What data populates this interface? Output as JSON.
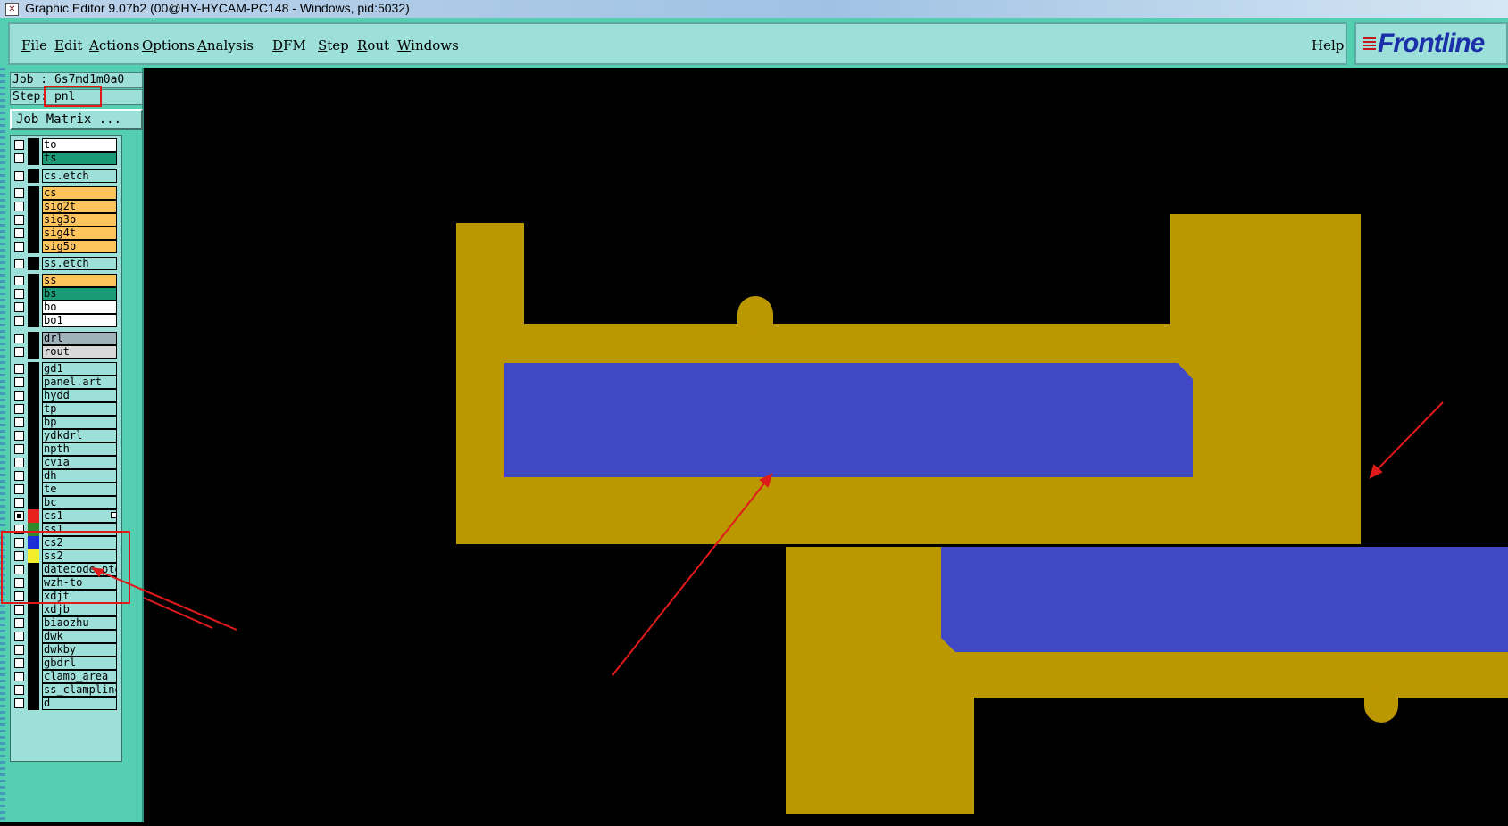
{
  "window": {
    "title": "Graphic Editor 9.07b2 (00@HY-HYCAM-PC148 - Windows, pid:5032)"
  },
  "menu": {
    "items": [
      {
        "label": "File",
        "accel_index": 0
      },
      {
        "label": "Edit",
        "accel_index": 0
      },
      {
        "label": "Actions",
        "accel_index": 0
      },
      {
        "label": "Options",
        "accel_index": 0
      },
      {
        "label": "Analysis",
        "accel_index": 0
      },
      {
        "label": "DFM",
        "accel_index": 0
      },
      {
        "label": "Step",
        "accel_index": 0
      },
      {
        "label": "Rout",
        "accel_index": 0
      },
      {
        "label": "Windows",
        "accel_index": 0
      }
    ],
    "help": "Help"
  },
  "logo": {
    "text": "Frontline",
    "color": "#1a2fa8",
    "accent": "#c8161d"
  },
  "job": {
    "label": "Job : 6s7md1m0a0"
  },
  "step": {
    "label": "Step: pnl"
  },
  "job_matrix": {
    "label": "Job Matrix ..."
  },
  "colors": {
    "panel_bg": "#54cfb2",
    "field_bg": "#9ddfd9",
    "copper": "#bb9700",
    "blue_feature": "#4148c5",
    "annotation": "#e01a1a"
  },
  "layers": [
    {
      "name": "to",
      "bg": "#ffffff",
      "color": null,
      "checked": false
    },
    {
      "name": "ts",
      "bg": "#1b9a77",
      "color": null,
      "checked": false
    },
    {
      "name": "cs.etch",
      "bg": "#9ddfd9",
      "color": null,
      "checked": false
    },
    {
      "name": "cs",
      "bg": "#fdc35c",
      "color": null,
      "checked": false
    },
    {
      "name": "sig2t",
      "bg": "#fdc35c",
      "color": null,
      "checked": false
    },
    {
      "name": "sig3b",
      "bg": "#fdc35c",
      "color": null,
      "checked": false
    },
    {
      "name": "sig4t",
      "bg": "#fdc35c",
      "color": null,
      "checked": false
    },
    {
      "name": "sig5b",
      "bg": "#fdc35c",
      "color": null,
      "checked": false
    },
    {
      "name": "ss.etch",
      "bg": "#9ddfd9",
      "color": null,
      "checked": false
    },
    {
      "name": "ss",
      "bg": "#fdc35c",
      "color": null,
      "checked": false
    },
    {
      "name": "bs",
      "bg": "#1b9a77",
      "color": null,
      "checked": false
    },
    {
      "name": "bo",
      "bg": "#ffffff",
      "color": null,
      "checked": false
    },
    {
      "name": "bo1",
      "bg": "#ffffff",
      "color": null,
      "checked": false
    },
    {
      "name": "drl",
      "bg": "#9fb2b9",
      "color": null,
      "checked": false
    },
    {
      "name": "rout",
      "bg": "#d8d8d8",
      "color": null,
      "checked": false
    },
    {
      "name": "gd1",
      "bg": "#9ddfd9",
      "color": null,
      "checked": false
    },
    {
      "name": "panel.art",
      "bg": "#9ddfd9",
      "color": null,
      "checked": false
    },
    {
      "name": "hydd",
      "bg": "#9ddfd9",
      "color": null,
      "checked": false
    },
    {
      "name": "tp",
      "bg": "#9ddfd9",
      "color": null,
      "checked": false
    },
    {
      "name": "bp",
      "bg": "#9ddfd9",
      "color": null,
      "checked": false
    },
    {
      "name": "ydkdrl",
      "bg": "#9ddfd9",
      "color": null,
      "checked": false
    },
    {
      "name": "npth",
      "bg": "#9ddfd9",
      "color": null,
      "checked": false
    },
    {
      "name": "cvia",
      "bg": "#9ddfd9",
      "color": null,
      "checked": false
    },
    {
      "name": "dh",
      "bg": "#9ddfd9",
      "color": null,
      "checked": false
    },
    {
      "name": "te",
      "bg": "#9ddfd9",
      "color": null,
      "checked": false
    },
    {
      "name": "bc",
      "bg": "#9ddfd9",
      "color": null,
      "checked": false
    },
    {
      "name": "cs1",
      "bg": "#9ddfd9",
      "color": "#e8211d",
      "checked": true
    },
    {
      "name": "ss1",
      "bg": "#9ddfd9",
      "color": "#2f8a2a",
      "checked": false
    },
    {
      "name": "cs2",
      "bg": "#9ddfd9",
      "color": "#1c2fd8",
      "checked": false
    },
    {
      "name": "ss2",
      "bg": "#9ddfd9",
      "color": "#f4ee2a",
      "checked": false
    },
    {
      "name": "datecode-pte",
      "bg": "#9ddfd9",
      "color": null,
      "checked": false
    },
    {
      "name": "wzh-to",
      "bg": "#9ddfd9",
      "color": null,
      "checked": false
    },
    {
      "name": "xdjt",
      "bg": "#9ddfd9",
      "color": null,
      "checked": false
    },
    {
      "name": "xdjb",
      "bg": "#9ddfd9",
      "color": null,
      "checked": false
    },
    {
      "name": "biaozhu",
      "bg": "#9ddfd9",
      "color": null,
      "checked": false
    },
    {
      "name": "dwk",
      "bg": "#9ddfd9",
      "color": null,
      "checked": false
    },
    {
      "name": "dwkby",
      "bg": "#9ddfd9",
      "color": null,
      "checked": false
    },
    {
      "name": "gbdrl",
      "bg": "#9ddfd9",
      "color": null,
      "checked": false
    },
    {
      "name": "clamp_area",
      "bg": "#9ddfd9",
      "color": null,
      "checked": false
    },
    {
      "name": "ss_clampline",
      "bg": "#9ddfd9",
      "color": null,
      "checked": false
    },
    {
      "name": "d",
      "bg": "#9ddfd9",
      "color": null,
      "checked": false
    }
  ]
}
